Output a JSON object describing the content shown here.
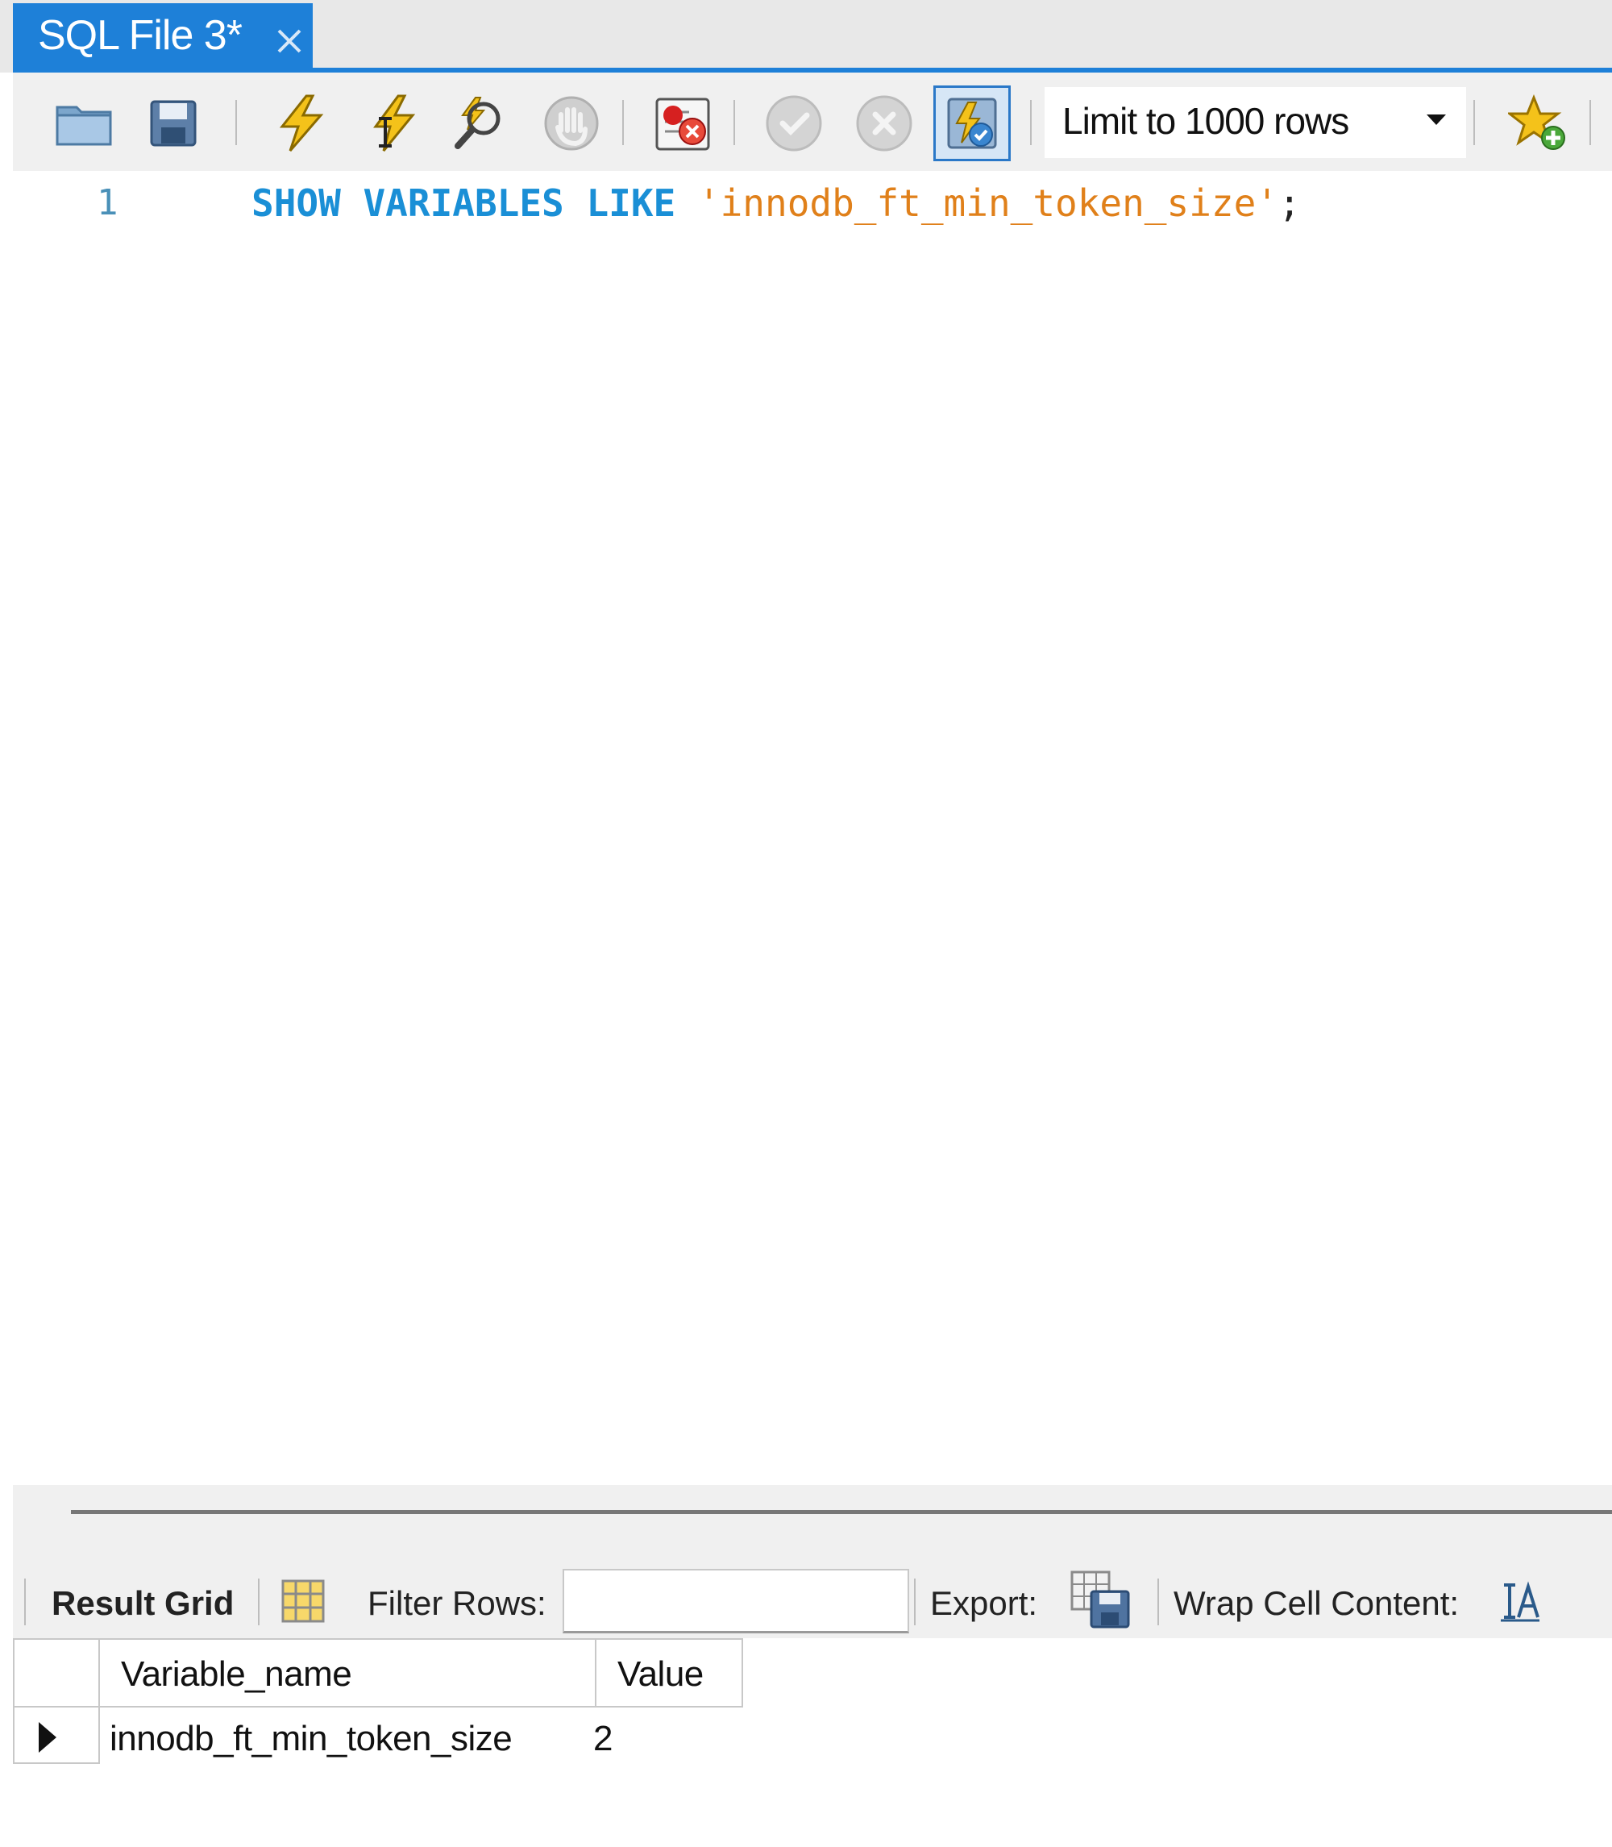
{
  "tab": {
    "title": "SQL File 3*"
  },
  "toolbar": {
    "buttons": [
      {
        "name": "open-file",
        "icon": "folder-icon"
      },
      {
        "name": "save-file",
        "icon": "floppy-disk-icon"
      },
      {
        "name": "execute-all",
        "icon": "lightning-icon"
      },
      {
        "name": "execute-current",
        "icon": "lightning-cursor-icon"
      },
      {
        "name": "explain",
        "icon": "magnifier-icon"
      },
      {
        "name": "stop",
        "icon": "hand-stop-icon"
      },
      {
        "name": "toggle-continue-on-error",
        "icon": "error-stop-icon"
      },
      {
        "name": "commit",
        "icon": "check-circle-icon"
      },
      {
        "name": "rollback",
        "icon": "x-circle-icon"
      },
      {
        "name": "toggle-autocommit",
        "icon": "autocommit-icon"
      },
      {
        "name": "add-snippet",
        "icon": "star-plus-icon"
      }
    ],
    "limit_label": "Limit to 1000 rows"
  },
  "editor": {
    "line_number": "1",
    "tokens": {
      "kw1": "SHOW",
      "kw2": "VARIABLES",
      "kw3": "LIKE",
      "string": "'innodb_ft_min_token_size'",
      "terminator": ";"
    }
  },
  "result_toolbar": {
    "result_grid_label": "Result Grid",
    "filter_label": "Filter Rows:",
    "filter_value": "",
    "export_label": "Export:",
    "wrap_label": "Wrap Cell Content:"
  },
  "result_grid": {
    "columns": [
      "Variable_name",
      "Value"
    ],
    "rows": [
      [
        "innodb_ft_min_token_size",
        "2"
      ]
    ]
  },
  "colors": {
    "accent": "#1e80d8",
    "keyword": "#1a8fd6",
    "string": "#e0801a",
    "line_number": "#4a90b8"
  }
}
